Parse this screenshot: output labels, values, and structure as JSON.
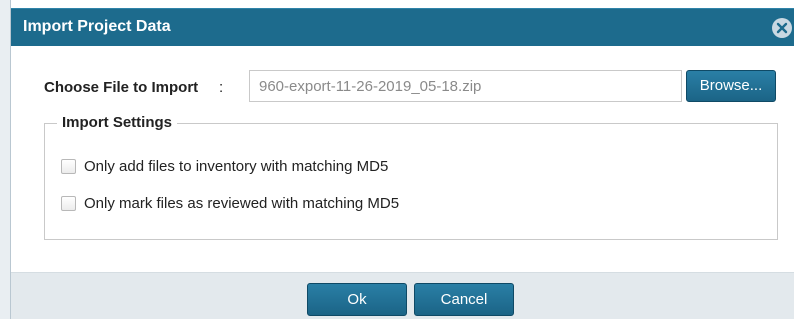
{
  "dialog": {
    "title": "Import Project Data",
    "close_icon": "close-circle-icon"
  },
  "file": {
    "label": "Choose File to Import",
    "colon": ":",
    "value": "960-export-11-26-2019_05-18.zip",
    "browse_label": "Browse..."
  },
  "settings": {
    "legend": "Import Settings",
    "options": [
      {
        "label": "Only add files to inventory with matching MD5",
        "checked": false
      },
      {
        "label": "Only mark files as reviewed with matching MD5",
        "checked": false
      }
    ]
  },
  "footer": {
    "ok_label": "Ok",
    "cancel_label": "Cancel"
  },
  "colors": {
    "titlebar": "#1d6b8d",
    "button": "#1b6486",
    "footer": "#e3e9ed"
  }
}
